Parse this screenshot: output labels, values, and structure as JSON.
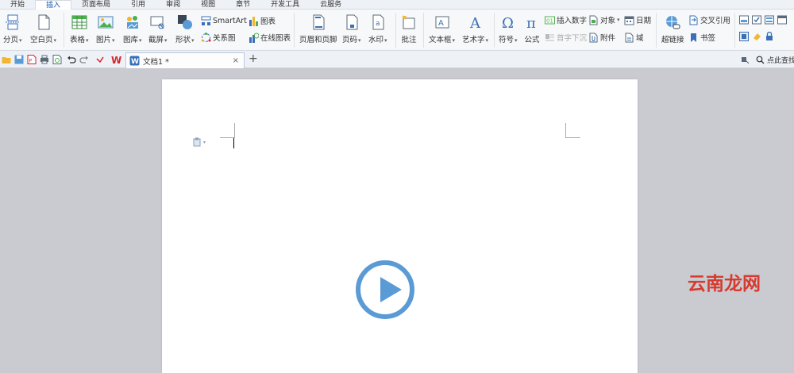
{
  "menu": {
    "tabs": [
      "开始",
      "插入",
      "页面布局",
      "引用",
      "审阅",
      "视图",
      "章节",
      "开发工具",
      "云服务"
    ],
    "active": "插入"
  },
  "ribbon": {
    "page_break": "分页",
    "blank_page": "空白页",
    "table": "表格",
    "picture": "图片",
    "gallery": "图库",
    "screenshot": "截屏",
    "shapes": "形状",
    "smartart": "SmartArt",
    "chart": "图表",
    "relation": "关系图",
    "online_chart": "在线图表",
    "header_footer": "页眉和页脚",
    "page_number": "页码",
    "watermark": "水印",
    "comment": "批注",
    "textbox": "文本框",
    "wordart": "艺术字",
    "symbol": "符号",
    "formula": "公式",
    "insert_number": "插入数字",
    "object": "对象",
    "date": "日期",
    "drop_cap": "首字下沉",
    "attachment": "附件",
    "field": "域",
    "hyperlink": "超链接",
    "cross_ref": "交叉引用",
    "bookmark": "书签"
  },
  "doc": {
    "tab_name": "文档1 *",
    "close": "×",
    "add": "+",
    "search_label": "点此查找"
  },
  "watermark_text": "云南龙网",
  "colors": {
    "accent": "#1a5fb4",
    "play": "#5b9bd5",
    "wps_red": "#d7262e"
  }
}
